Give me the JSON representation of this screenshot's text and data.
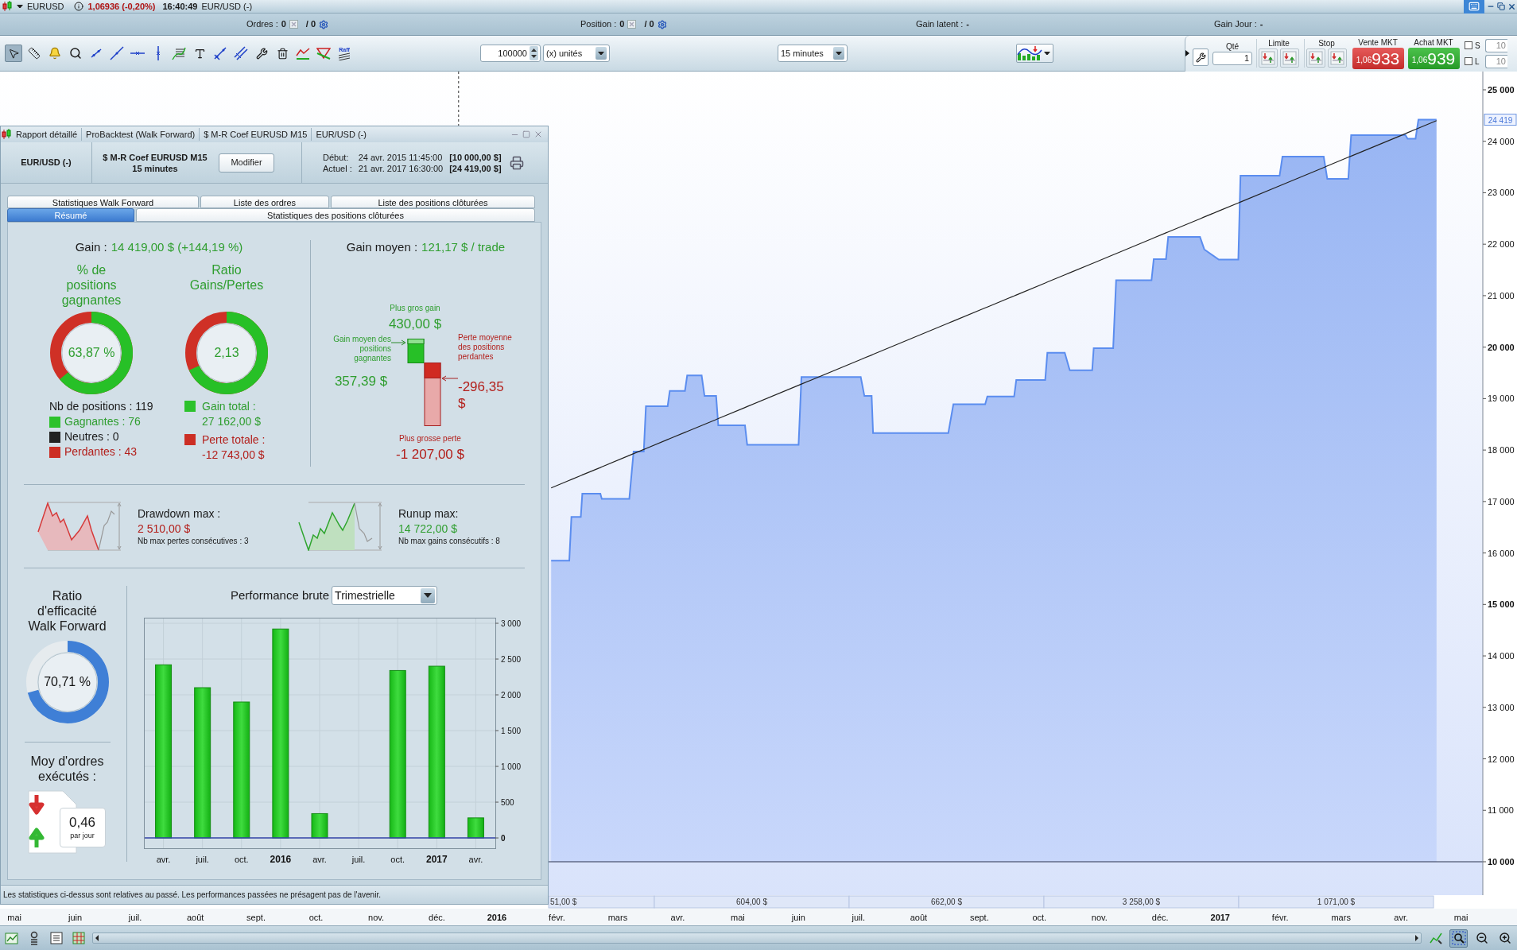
{
  "top_bar": {
    "symbol": "EURUSD",
    "price_change": "1,06936 (-0,20%)",
    "time": "16:40:49",
    "instrument": "EUR/USD (-)"
  },
  "info_bar": [
    {
      "kind": "count",
      "label": "Ordres :",
      "value": "0",
      "total": "/ 0"
    },
    {
      "kind": "count",
      "label": "Position :",
      "value": "0",
      "total": "/ 0"
    },
    {
      "kind": "text",
      "label": "Gain latent :",
      "value": "-"
    },
    {
      "kind": "text",
      "label": "Gain Jour :",
      "value": "-"
    }
  ],
  "toolbar": {
    "tools": [
      {
        "selected": true
      },
      {
        "selected": false
      },
      {
        "selected": false
      },
      {
        "selected": false
      },
      {
        "selected": false
      },
      {
        "selected": false
      },
      {
        "selected": false
      },
      {
        "selected": false
      },
      {
        "selected": false
      },
      {
        "selected": false
      },
      {
        "selected": false
      },
      {
        "selected": false
      },
      {
        "selected": false
      },
      {
        "selected": false
      },
      {
        "selected": false
      },
      {
        "selected": false
      },
      {
        "selected": false,
        "label": "Raff"
      }
    ],
    "quantity": "100000",
    "unit": "(x) unités",
    "timeframe": "15 minutes"
  },
  "order_panel": {
    "qty_label": "Qté",
    "qty": "1",
    "limit_label": "Limite",
    "stop_label": "Stop",
    "sell": {
      "label": "Vente MKT",
      "prefix": "1,06",
      "price": "933"
    },
    "buy": {
      "label": "Achat MKT",
      "prefix": "1,06",
      "price": "939"
    },
    "options": [
      {
        "label": "S",
        "checked": false,
        "placeholder": "10"
      },
      {
        "label": "L",
        "checked": false,
        "placeholder": "10"
      }
    ]
  },
  "main_chart": {
    "chart_data": {
      "type": "area",
      "ref_lines": [
        {
          "axis": "y",
          "value": 10000,
          "color": "#2c3550"
        },
        {
          "axis": "x",
          "value": 2015.947,
          "color": "#333333"
        }
      ],
      "x": [
        2016.075,
        2016.1,
        2016.103,
        2016.116,
        2016.118,
        2016.143,
        2016.145,
        2016.183,
        2016.189,
        2016.203,
        2016.206,
        2016.236,
        2016.239,
        2016.26,
        2016.263,
        2016.283,
        2016.287,
        2016.303,
        2016.306,
        2016.343,
        2016.346,
        2016.417,
        2016.421,
        2016.503,
        2016.508,
        2016.518,
        2016.52,
        2016.624,
        2016.631,
        2016.675,
        2016.678,
        2016.715,
        2016.718,
        2016.758,
        2016.761,
        2016.785,
        2016.792,
        2016.823,
        2016.825,
        2016.852,
        2016.856,
        2016.905,
        2016.908,
        2016.925,
        2016.928,
        2016.972,
        2016.978,
        2016.998,
        2017.025,
        2017.028,
        2017.082,
        2017.086,
        2017.143,
        2017.148,
        2017.177,
        2017.181,
        2017.256,
        2017.259,
        2017.27,
        2017.274,
        2017.299
      ],
      "series": [
        {
          "type": "area",
          "color": "#5b8def",
          "values": [
            15850,
            15850,
            16700,
            16700,
            17150,
            17150,
            17050,
            17050,
            17970,
            17970,
            18850,
            18850,
            19150,
            19150,
            19450,
            19450,
            19050,
            19050,
            18480,
            18480,
            18100,
            18100,
            19420,
            19420,
            19050,
            19050,
            18330,
            18330,
            18890,
            18890,
            19040,
            19040,
            19360,
            19360,
            19890,
            19890,
            19550,
            19550,
            19980,
            19980,
            21300,
            21300,
            21710,
            21710,
            22140,
            22140,
            21900,
            21700,
            21700,
            23330,
            23330,
            23700,
            23700,
            23270,
            23270,
            24120,
            24120,
            24050,
            24050,
            24420,
            24420
          ]
        },
        {
          "type": "line",
          "color": "#222222",
          "values": [
            17265,
            17411,
            17428,
            17504,
            17516,
            17661,
            17673,
            17895,
            17930,
            18011,
            18029,
            18204,
            18221,
            18343,
            18361,
            18477,
            18501,
            18594,
            18612,
            18827,
            18845,
            19259,
            19282,
            19760,
            19789,
            19847,
            19859,
            20465,
            20506,
            20763,
            20780,
            20996,
            21013,
            21246,
            21264,
            21404,
            21445,
            21625,
            21637,
            21794,
            21818,
            22103,
            22121,
            22220,
            22237,
            22494,
            22529,
            22645,
            22803,
            22820,
            23135,
            23158,
            23491,
            23520,
            23689,
            23712,
            24149,
            24167,
            24231,
            24254,
            24400
          ]
        }
      ],
      "xlim": [
        2015.313,
        2017.363
      ],
      "ylim": [
        9351,
        25355
      ],
      "xticks": [
        {
          "value": 2015.333,
          "label": "mai"
        },
        {
          "value": 2015.417,
          "label": "juin"
        },
        {
          "value": 2015.5,
          "label": "juil."
        },
        {
          "value": 2015.583,
          "label": "août"
        },
        {
          "value": 2015.667,
          "label": "sept."
        },
        {
          "value": 2015.75,
          "label": "oct."
        },
        {
          "value": 2015.833,
          "label": "nov."
        },
        {
          "value": 2015.917,
          "label": "déc."
        },
        {
          "value": 2016,
          "label": "2016"
        },
        {
          "value": 2016.083,
          "label": "févr."
        },
        {
          "value": 2016.167,
          "label": "mars"
        },
        {
          "value": 2016.25,
          "label": "avr."
        },
        {
          "value": 2016.333,
          "label": "mai"
        },
        {
          "value": 2016.417,
          "label": "juin"
        },
        {
          "value": 2016.5,
          "label": "juil."
        },
        {
          "value": 2016.583,
          "label": "août"
        },
        {
          "value": 2016.667,
          "label": "sept."
        },
        {
          "value": 2016.75,
          "label": "oct."
        },
        {
          "value": 2016.833,
          "label": "nov."
        },
        {
          "value": 2016.917,
          "label": "déc."
        },
        {
          "value": 2017,
          "label": "2017"
        },
        {
          "value": 2017.083,
          "label": "févr."
        },
        {
          "value": 2017.167,
          "label": "mars"
        },
        {
          "value": 2017.25,
          "label": "avr."
        },
        {
          "value": 2017.333,
          "label": "mai"
        }
      ],
      "yticks": [
        {
          "value": 10000,
          "label": "10 000"
        },
        {
          "value": 11000,
          "label": "11 000"
        },
        {
          "value": 12000,
          "label": "12 000"
        },
        {
          "value": 13000,
          "label": "13 000"
        },
        {
          "value": 14000,
          "label": "14 000"
        },
        {
          "value": 15000,
          "label": "15 000"
        },
        {
          "value": 16000,
          "label": "16 000"
        },
        {
          "value": 17000,
          "label": "17 000"
        },
        {
          "value": 18000,
          "label": "18 000"
        },
        {
          "value": 19000,
          "label": "19 000"
        },
        {
          "value": 20000,
          "label": "20 000"
        },
        {
          "value": 21000,
          "label": "21 000"
        },
        {
          "value": 22000,
          "label": "22 000"
        },
        {
          "value": 23000,
          "label": "23 000"
        },
        {
          "value": 24000,
          "label": "24 000"
        },
        {
          "value": 25000,
          "label": "25 000"
        }
      ],
      "annotations": [
        {
          "y": 24419,
          "text": "24 419"
        }
      ]
    }
  },
  "period_gains": [
    "51,00 $",
    "604,00 $",
    "662,00 $",
    "3 258,00 $",
    "1 071,00 $"
  ],
  "report": {
    "title_parts": [
      "Rapport détaillé",
      "ProBacktest (Walk Forward)",
      "$ M-R Coef EURUSD M15",
      "EUR/USD (-)"
    ],
    "header": {
      "instrument": "EUR/USD (-)",
      "system": "$ M-R Coef EURUSD M15",
      "timeframe": "15 minutes",
      "modify_button": "Modifier",
      "start_label": "Début:",
      "start_date": "24 avr. 2015 11:45:00",
      "start_capital": "[10 000,00 $]",
      "current_label": "Actuel :",
      "current_date": "21 avr. 2017 16:30:00",
      "current_capital": "[24 419,00 $]"
    },
    "tab_rows": [
      {
        "tabs": [
          {
            "label": "Statistiques Walk Forward",
            "selected": false
          },
          {
            "label": "Liste des ordres",
            "selected": false
          },
          {
            "label": "Liste des positions clôturées",
            "selected": false
          }
        ]
      },
      {
        "tabs": [
          {
            "label": "Résumé",
            "selected": true
          },
          {
            "label": "Statistiques des positions clôturées",
            "selected": false
          }
        ]
      }
    ],
    "gain": {
      "label": "Gain :",
      "value": "14 419,00 $ (+144,19 %)"
    },
    "rings": [
      {
        "title": "% de positions gagnantes",
        "value": "63,87 %"
      },
      {
        "title": "Ratio Gains/Pertes",
        "value": "2,13"
      }
    ],
    "positions": {
      "label": "Nb de positions : 119",
      "items": [
        {
          "label": "Gagnantes : 76",
          "kind": "win",
          "color": "#2cc22c"
        },
        {
          "label": "Neutres : 0",
          "kind": "neutral",
          "color": "#222222"
        },
        {
          "label": "Perdantes : 43",
          "kind": "loss",
          "color": "#cc2e24"
        }
      ]
    },
    "totals": [
      {
        "label": "Gain total :",
        "value": "27 162,00 $",
        "kind": "win",
        "color": "#2cc22c"
      },
      {
        "label": "Perte totale :",
        "value": "-12 743,00 $",
        "kind": "loss",
        "color": "#cc2e24"
      }
    ],
    "avg_gain": {
      "label": "Gain moyen :",
      "value": "121,17 $ / trade"
    },
    "extremes": {
      "max_gain_label": "Plus gros gain",
      "max_gain": "430,00 $",
      "avg_win_label": "Gain moyen des positions gagnantes",
      "avg_win": "357,39 $",
      "avg_loss_label": "Perte moyenne des positions perdantes",
      "avg_loss": "-296,35 $",
      "max_loss_label": "Plus grosse perte",
      "max_loss": "-1 207,00 $"
    },
    "swings": [
      {
        "kind": "drawdown",
        "label": "Drawdown max :",
        "value": "2 510,00 $",
        "note": "Nb max pertes consécutives : 3"
      },
      {
        "kind": "runup",
        "label": "Runup max:",
        "value": "14 722,00 $",
        "note": "Nb max gains consécutifs : 8"
      }
    ],
    "efficiency": {
      "title": "Ratio d'efficacité Walk Forward",
      "value": "70,71 %"
    },
    "orders_per_day": {
      "title": "Moy d'ordres exécutés :",
      "value": "0,46",
      "unit": "par jour"
    },
    "performance": {
      "title": "Performance brute",
      "period": "Trimestrielle",
      "chart_data": {
        "type": "bar",
        "grid": true,
        "ref_lines": [
          {
            "axis": "y",
            "value": 0,
            "color": "#3545a8"
          }
        ],
        "categories": [
          "avr.",
          "juil.",
          "oct.",
          "2016",
          "avr.",
          "juil.",
          "oct.",
          "2017",
          "avr."
        ],
        "values": [
          2420,
          2100,
          1900,
          2920,
          340,
          0,
          2340,
          2400,
          280
        ],
        "ylim": [
          -144,
          3078
        ],
        "yticks": [
          {
            "value": 0,
            "label": "0"
          },
          {
            "value": 500,
            "label": "500"
          },
          {
            "value": 1000,
            "label": "1 000"
          },
          {
            "value": 1500,
            "label": "1 500"
          },
          {
            "value": 2000,
            "label": "2 000"
          },
          {
            "value": 2500,
            "label": "2 500"
          },
          {
            "value": 3000,
            "label": "3 000"
          }
        ]
      }
    },
    "disclaimer": "Les statistiques ci-dessus sont relatives au passé. Les performances passées ne présagent pas de l'avenir."
  },
  "bottom_bar": {
    "right_tools": [
      {
        "selected": false
      },
      {
        "selected": true
      },
      {
        "selected": false
      },
      {
        "selected": false
      }
    ]
  }
}
